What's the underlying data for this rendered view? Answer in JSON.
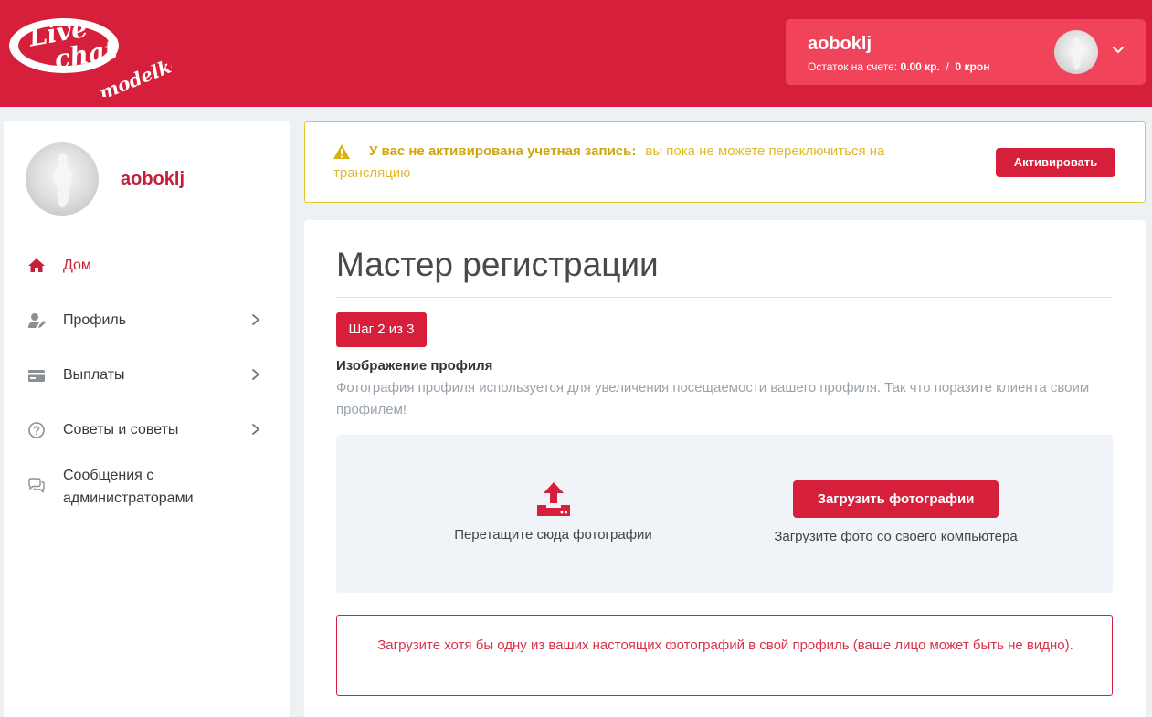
{
  "brand": {
    "logo_line1": "Live",
    "logo_line2": "chat",
    "logo_line3": "modelka",
    "primary_color": "#d61f3a",
    "account_bg_color": "#f1435a",
    "warning_color": "#e0b92a"
  },
  "header": {
    "username": "aoboklj",
    "balance_label": "Остаток на счете:",
    "balance_kr": "0.00 кр.",
    "balance_separator": "/",
    "balance_kron": "0 крон",
    "avatar_icon": "user-avatar",
    "menu_icon": "chevron-down-icon"
  },
  "sidebar": {
    "username": "aoboklj",
    "items": [
      {
        "label": "Дом",
        "icon": "home-icon",
        "active": true,
        "has_arrow": false
      },
      {
        "label": "Профиль",
        "icon": "user-edit-icon",
        "active": false,
        "has_arrow": true
      },
      {
        "label": "Выплаты",
        "icon": "credit-card-icon",
        "active": false,
        "has_arrow": true
      },
      {
        "label": "Советы и советы",
        "icon": "question-circle-icon",
        "active": false,
        "has_arrow": true
      },
      {
        "label": "Сообщения с администраторами",
        "icon": "chat-bubbles-icon",
        "active": false,
        "has_arrow": false
      }
    ]
  },
  "alert": {
    "title": "У вас не активирована учетная запись:",
    "message": "вы пока не можете переключиться на трансляцию",
    "button_label": "Активировать",
    "icon": "warning-icon"
  },
  "wizard": {
    "title": "Мастер регистрации",
    "step_label": "Шаг 2 из 3",
    "section_title": "Изображение профиля",
    "section_description": "Фотография профиля используется для увеличения посещаемости вашего профиля. Так что поразите клиента своим профилем!",
    "drop_label": "Перетащите сюда фотографии",
    "upload_button_label": "Загрузить фотографии",
    "upload_hint": "Загрузите фото со своего компьютера",
    "upload_icon": "upload-icon",
    "warning_message": "Загрузите хотя бы одну из ваших настоящих фотографий в свой профиль (ваше лицо может быть не видно)."
  }
}
